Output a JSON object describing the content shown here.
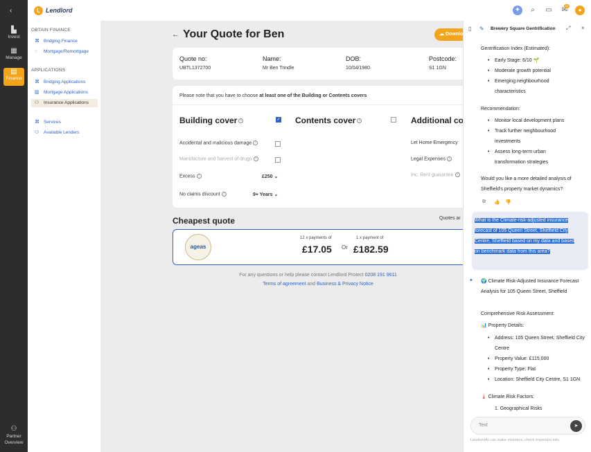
{
  "app": {
    "brand": "Lendlord",
    "accent": "#f2a51a",
    "link_color": "#2e64c4"
  },
  "rail": [
    {
      "label": "Invest",
      "icon": "chart-icon"
    },
    {
      "label": "Manage",
      "icon": "grid-icon"
    },
    {
      "label": "Finance",
      "icon": "finance-icon",
      "active": true
    },
    {
      "label": "Partner Overview",
      "icon": "partner-icon"
    }
  ],
  "sidebar": {
    "obtain_finance": "OBTAIN FINANCE",
    "obtain_items": [
      "Bridging Finance",
      "Mortgage/Remortgage"
    ],
    "applications": "APPLICATIONS",
    "app_items": [
      "Bridging Applications",
      "Mortgage Applications",
      "Insurance Applications"
    ],
    "other_items": [
      "Services",
      "Available Lenders"
    ]
  },
  "topbar": {
    "notif_count": "10"
  },
  "quote": {
    "title": "Your Quote for Ben",
    "download_label": "Downlo",
    "quote_no_label": "Quote no:",
    "quote_no": "UBTL1372700",
    "name_label": "Name:",
    "name": "Mr Ben Trindle",
    "dob_label": "DOB:",
    "dob": "10/04/1980",
    "postcode_label": "Postcode:",
    "postcode": "S1 1GN",
    "note_prefix": "Please note that you have to choose ",
    "note_bold": "at least one of the Building or Contents covers",
    "building_title": "Building cover",
    "contents_title": "Contents cover",
    "additional_title": "Additional co",
    "building_rows": [
      {
        "label": "Accidental and malicious damage",
        "dim": false
      },
      {
        "label": "Manufacture and harvest of drugs",
        "dim": true
      }
    ],
    "excess_label": "Excess",
    "excess_value": "£250",
    "ncd_label": "No claims discount",
    "ncd_value": "9+ Years",
    "additional_rows": [
      {
        "label": "Let Home Emergency",
        "dim": false
      },
      {
        "label": "Legal Expenses",
        "dim": false
      },
      {
        "label": "Inc. Rent guarantee",
        "dim": true
      }
    ],
    "cheapest_label": "Cheapest quote",
    "quotes_label": "Quotes ar",
    "insurer_logo": "ageas",
    "monthly_label": "12 x payments of",
    "monthly_value": "£17.05",
    "or_label": "Or",
    "annual_label": "1 x payment of",
    "annual_value": "£182.59",
    "contact_prefix": "For any questions or help please contact Lendlord Protect",
    "contact_phone": "0208 191 9611",
    "terms_label": "Terms of agreement",
    "and_label": "and",
    "privacy_label": "Business & Privacy Notice"
  },
  "chat": {
    "header_title": "Brewery Square Gentrification",
    "gent_index": "Gentrification Index (Estimated):",
    "stage_items": [
      "Early Stage: 6/10 🌱",
      "Moderate growth potential",
      "Emerging neighbourhood characteristics"
    ],
    "recommendation": "Recommendation:",
    "rec_items": [
      "Monitor local development plans",
      "Track further neighbourhood investments",
      "Assess long-term urban transformation strategies"
    ],
    "followup": "Would you like a more detailed analysis of Sheffield's property market dynamics?",
    "user_message": "What is the Climate-risk-adjusted insurance forecast of 105 Queen Street, Sheffield City Centre, Sheffield based on my data and based on benchmark data from this area?",
    "answer_title": "🌍 Climate Risk-Adjusted Insurance Forecast Analysis for 105 Queen Street, Sheffield",
    "comprehensive": "Comprehensive Risk Assessment:",
    "prop_details": "📊 Property Details:",
    "prop_items": [
      "Address: 105 Queen Street, Sheffield City Centre",
      "Property Value: £115,000",
      "Property Type: Flat",
      "Location: Sheffield City Centre, S1 1GN"
    ],
    "climate_factors": "🌡️ Climate Risk Factors:",
    "factor_items": [
      "1. Geographical Risks"
    ],
    "input_placeholder": "Text",
    "disclaimer": "LendlordAI can make mistakes, check important info."
  }
}
